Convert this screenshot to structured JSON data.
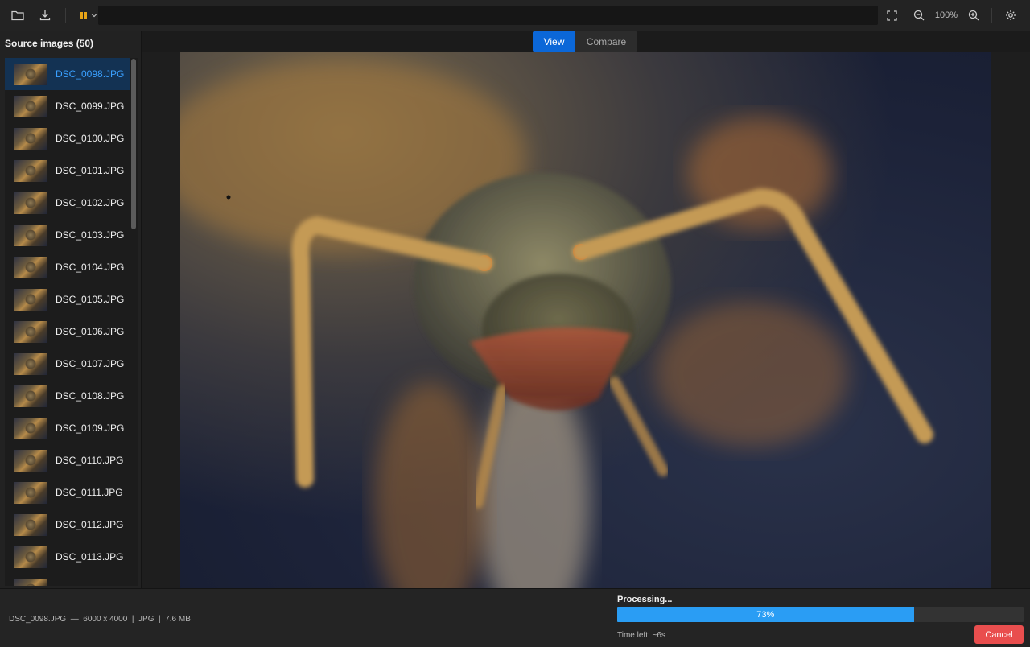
{
  "toolbar": {
    "icons": [
      "folder-icon",
      "download-icon",
      "pause-icon",
      "chevron-down-icon",
      "fullscreen-icon",
      "zoom-out-icon",
      "zoom-in-icon",
      "gear-icon"
    ],
    "path_value": "",
    "zoom_level": "100%"
  },
  "sidebar": {
    "title": "Source images (50)",
    "files": [
      {
        "name": "DSC_0098.JPG",
        "selected": true
      },
      {
        "name": "DSC_0099.JPG"
      },
      {
        "name": "DSC_0100.JPG"
      },
      {
        "name": "DSC_0101.JPG"
      },
      {
        "name": "DSC_0102.JPG"
      },
      {
        "name": "DSC_0103.JPG"
      },
      {
        "name": "DSC_0104.JPG"
      },
      {
        "name": "DSC_0105.JPG"
      },
      {
        "name": "DSC_0106.JPG"
      },
      {
        "name": "DSC_0107.JPG"
      },
      {
        "name": "DSC_0108.JPG"
      },
      {
        "name": "DSC_0109.JPG"
      },
      {
        "name": "DSC_0110.JPG"
      },
      {
        "name": "DSC_0111.JPG"
      },
      {
        "name": "DSC_0112.JPG"
      },
      {
        "name": "DSC_0113.JPG"
      },
      {
        "name": ""
      }
    ]
  },
  "tabs": [
    {
      "label": "View",
      "active": true
    },
    {
      "label": "Compare",
      "active": false
    }
  ],
  "status": {
    "file_info": "DSC_0098.JPG  —  6000 x 4000  |  JPG  |  7.6 MB",
    "processing_label": "Processing...",
    "progress_percent": 73,
    "progress_text": "73%",
    "time_left": "Time left: ~6s",
    "cancel_label": "Cancel"
  },
  "colors": {
    "accent": "#0b67d8",
    "progress": "#2a9df4",
    "selected_text": "#3aa0ff",
    "cancel": "#e94e4e",
    "pause_icon": "#e8a417"
  }
}
